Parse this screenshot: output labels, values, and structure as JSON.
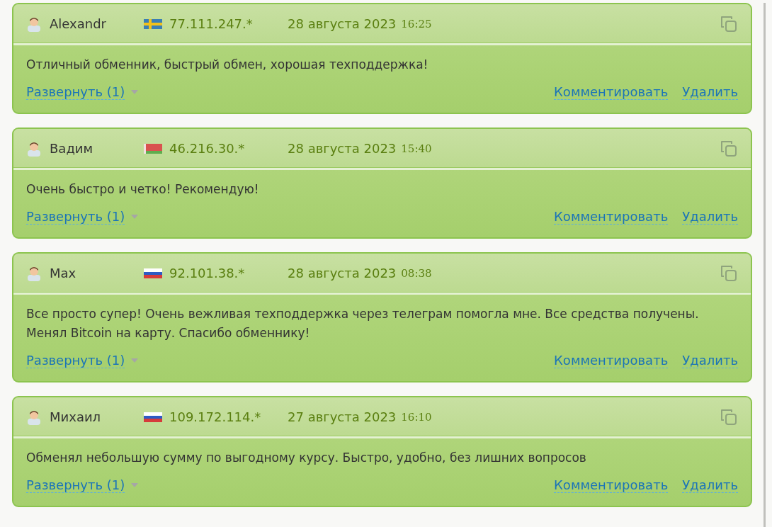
{
  "reviews": [
    {
      "author": "Alexandr",
      "flag": {
        "kind": "se"
      },
      "ip": "77.111.247.*",
      "date": "28 августа 2023",
      "time": "16:25",
      "text": "Отличный обменник, быстрый обмен, хорошая техподдержка!",
      "expand": "Развернуть (1)",
      "comment": "Комментировать",
      "delete": "Удалить"
    },
    {
      "author": "Вадим",
      "flag": {
        "kind": "by"
      },
      "ip": "46.216.30.*",
      "date": "28 августа 2023",
      "time": "15:40",
      "text": "Очень быстро и четко! Рекомендую!",
      "expand": "Развернуть (1)",
      "comment": "Комментировать",
      "delete": "Удалить"
    },
    {
      "author": "Max",
      "flag": {
        "kind": "ru"
      },
      "ip": "92.101.38.*",
      "date": "28 августа 2023",
      "time": "08:38",
      "text": "Все просто супер! Очень вежливая техподдержка через телеграм помогла мне. Все средства получены. Менял Bitcoin на карту. Спасибо обменнику!",
      "expand": "Развернуть (1)",
      "comment": "Комментировать",
      "delete": "Удалить"
    },
    {
      "author": "Михаил",
      "flag": {
        "kind": "ru"
      },
      "ip": "109.172.114.*",
      "date": "27 августа 2023",
      "time": "16:10",
      "text": "Обменял небольшую сумму по выгодному курсу. Быстро, удобно, без лишних вопросов",
      "expand": "Развернуть (1)",
      "comment": "Комментировать",
      "delete": "Удалить"
    }
  ]
}
